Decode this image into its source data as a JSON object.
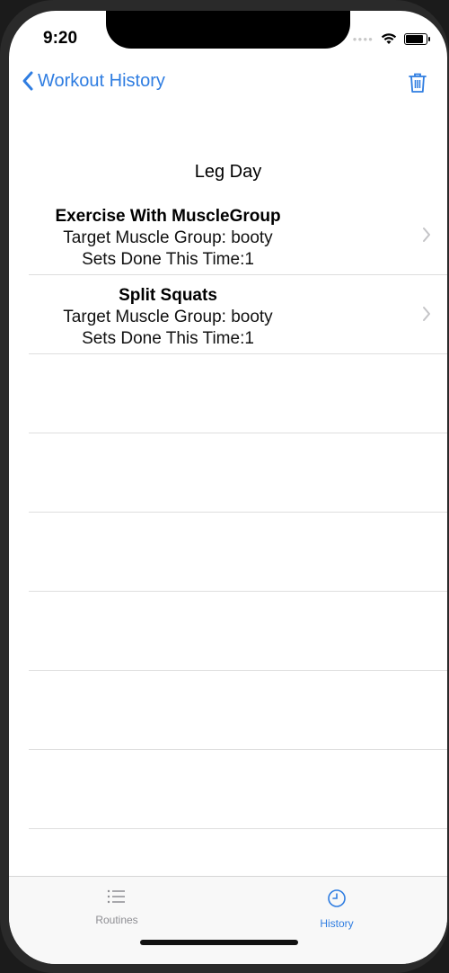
{
  "status": {
    "time": "9:20"
  },
  "navbar": {
    "back_label": "Workout History"
  },
  "section": {
    "title": "Leg Day"
  },
  "exercises": [
    {
      "title": "Exercise With MuscleGroup",
      "target": "Target Muscle Group: booty",
      "sets": "Sets Done This Time:1"
    },
    {
      "title": "Split Squats",
      "target": "Target Muscle Group: booty",
      "sets": "Sets Done This Time:1"
    }
  ],
  "tabs": [
    {
      "label": "Routines",
      "icon": "list-icon",
      "active": false
    },
    {
      "label": "History",
      "icon": "clock-icon",
      "active": true
    }
  ],
  "colors": {
    "accent": "#2f7de1",
    "inactive_tab": "#8e8e93"
  }
}
